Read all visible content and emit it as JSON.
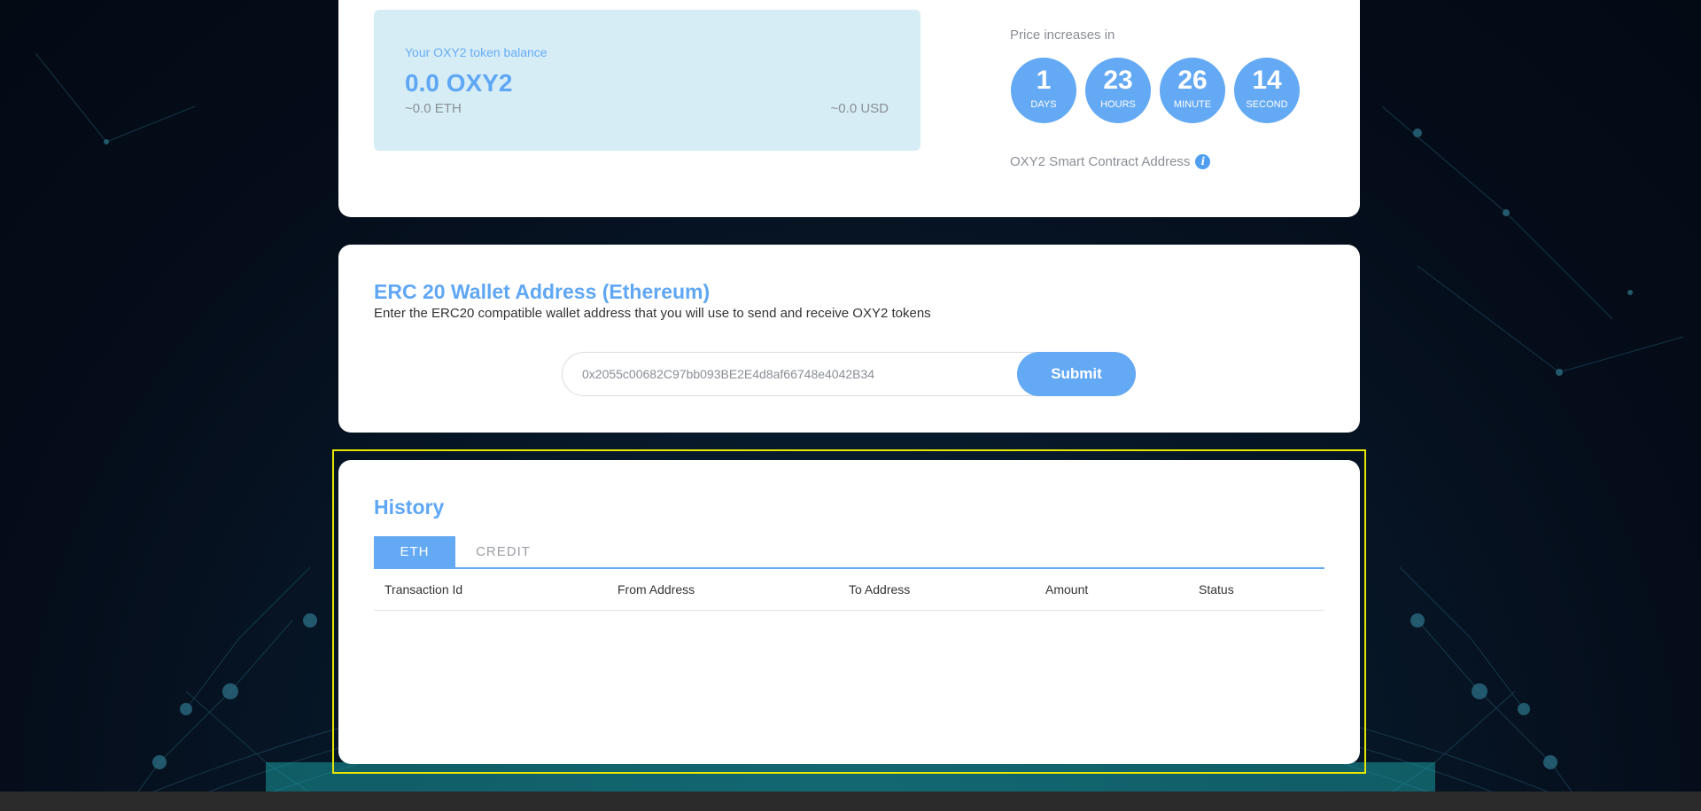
{
  "balance_card": {
    "label": "Your OXY2 token balance",
    "amount": "0.0 OXY2",
    "eth_value": "~0.0 ETH",
    "usd_value": "~0.0 USD"
  },
  "countdown": {
    "title": "Price increases in",
    "units": [
      {
        "value": "1",
        "label": "DAYS"
      },
      {
        "value": "23",
        "label": "HOURS"
      },
      {
        "value": "26",
        "label": "MINUTE"
      },
      {
        "value": "14",
        "label": "SECOND"
      }
    ]
  },
  "contract": {
    "label": "OXY2 Smart Contract Address",
    "info_icon": "i"
  },
  "wallet": {
    "title": "ERC 20 Wallet Address (Ethereum)",
    "description": "Enter the ERC20 compatible wallet address that you will use to send and receive OXY2 tokens",
    "input_value": "0x2055c00682C97bb093BE2E4d8af66748e4042B34",
    "submit_label": "Submit"
  },
  "history": {
    "title": "History",
    "tabs": [
      {
        "label": "ETH",
        "active": true
      },
      {
        "label": "CREDIT",
        "active": false
      }
    ],
    "columns": [
      "Transaction Id",
      "From Address",
      "To Address",
      "Amount",
      "Status"
    ],
    "rows": []
  },
  "colors": {
    "accent": "#64a9f4",
    "balance_bg": "#d6edf5",
    "highlight": "#e6e600"
  }
}
